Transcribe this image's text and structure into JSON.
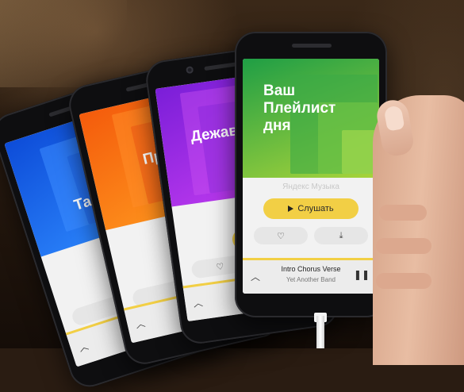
{
  "phones": [
    {
      "title": "Тайн",
      "theme": "blue"
    },
    {
      "title": "Пре",
      "theme": "orange"
    },
    {
      "title": "Дежав",
      "theme": "purple"
    },
    {
      "title": "Ваш\nПлейлист\nдня",
      "theme": "green",
      "brand": "Яндекс Музыка",
      "listen_label": "Слушать",
      "track": "Intro Chorus Verse",
      "artist": "Yet Another Band"
    }
  ],
  "icons": {
    "like": "heart-icon",
    "download": "download-icon",
    "play": "play-icon",
    "pause": "pause-icon",
    "expand": "chevron-up-icon"
  },
  "colors": {
    "accent": "#f2cf45",
    "blue": "#1a6cf0",
    "orange": "#f47a14",
    "purple": "#9a2ee4",
    "green": "#4fbb3f"
  }
}
